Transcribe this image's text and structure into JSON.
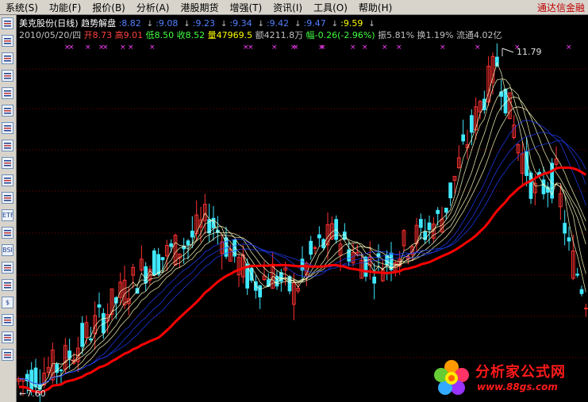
{
  "menu": {
    "items": [
      "系统(S)",
      "功能(F)",
      "报价(B)",
      "分析(A)",
      "港股期货",
      "增强(T)",
      "资讯(I)",
      "工具(O)",
      "帮助(H)"
    ],
    "brand": "通达信金融"
  },
  "toolbar": {
    "icons": [
      "list-icon",
      "grid-icon",
      "line-chart-icon",
      "candle-icon",
      "table-icon",
      "table2-icon",
      "quote-icon",
      "mail-icon",
      "people-icon",
      "analysis-icon",
      "search-icon",
      "etf-icon",
      "wave-icon",
      "bsi-icon",
      "news-icon",
      "calc-icon",
      "dollar-icon",
      "tool-icon",
      "pencil-icon",
      "chat-icon"
    ],
    "labels": [
      "",
      "",
      "",
      "",
      "",
      "",
      "",
      "",
      "",
      "",
      "",
      "ETF",
      "",
      "BSI",
      "",
      "",
      "$",
      "",
      "",
      ""
    ]
  },
  "header": {
    "title": "美克股份(日线)",
    "indicator_name": "趋势解盘",
    "indicator_values": [
      "8.82",
      "9.08",
      "9.23",
      "9.34",
      "9.42",
      "9.47",
      "9.59"
    ],
    "sep": ":",
    "date": "2010/05/20/四",
    "open_label": "开",
    "open": "8.73",
    "high_label": "高",
    "high": "9.01",
    "low_label": "低",
    "low": "8.50",
    "close_label": "收",
    "close": "8.52",
    "vol_label": "量",
    "vol": "47969.5",
    "amount_label": "额",
    "amount": "4211.8万",
    "change_label": "幅",
    "change": "-0.26(-2.96%)",
    "amp_label": "振",
    "amp": "5.81%",
    "turn_label": "换",
    "turn": "1.19%",
    "float_label": "流通",
    "float": "4.02亿"
  },
  "chart": {
    "max_label": "11.79",
    "min_label": "←7.60",
    "colors": {
      "up": "#ff3030",
      "down": "#40e8ff",
      "grid": "#800000",
      "trend_red": "#ff0000",
      "trend_green": "#00e000",
      "fan_yellow": "#ffffc0",
      "fan_blue": "#2040ff",
      "marker": "#ff40ff"
    }
  },
  "watermark": {
    "text1": "分析家公式网",
    "text2": "www.88gs.com"
  }
}
